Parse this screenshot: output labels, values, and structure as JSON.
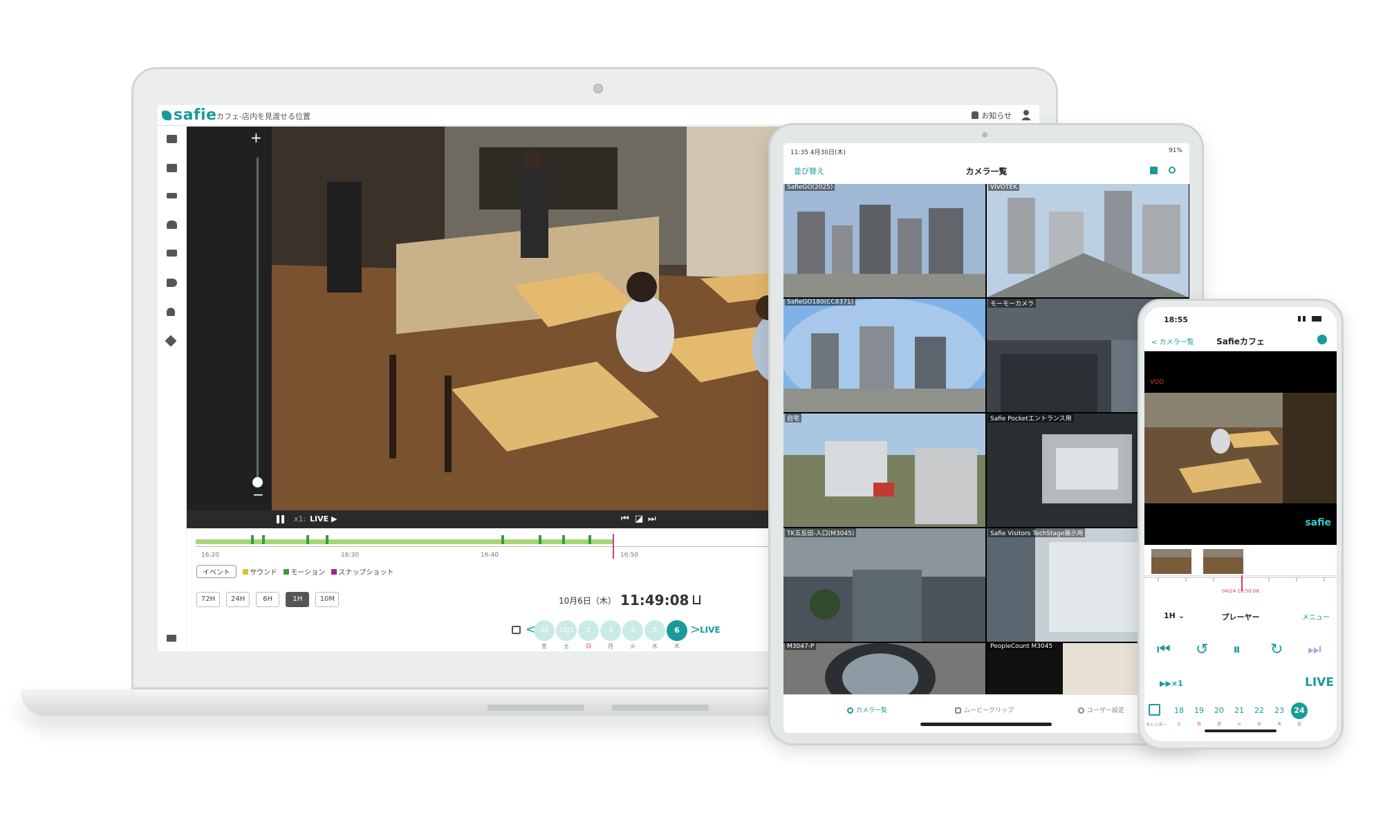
{
  "laptop": {
    "logo": "safie",
    "page_title": "カフェ-店内を見渡せる位置",
    "notice_label": "お知らせ",
    "sidebar_icons": [
      "camera-icon",
      "recorder-icon",
      "storage-icon",
      "cloud-download-icon",
      "list-check-icon",
      "megaphone-icon",
      "person-icon",
      "wrench-icon"
    ],
    "player": {
      "zoom_plus": "+",
      "zoom_minus": "−",
      "speed": "x1:",
      "live": "LIVE ▶",
      "prev_button": "⏮",
      "snapshot_button": "◪",
      "next_button": "⏭"
    },
    "timeline": {
      "ticks": [
        "16:20",
        "16:30",
        "16:40",
        "16:50"
      ]
    },
    "legend": {
      "box_label": "イベント",
      "items": [
        {
          "label": "サウンド",
          "color": "#d8c22a"
        },
        {
          "label": "モーション",
          "color": "#3a9b3a"
        },
        {
          "label": "スナップショット",
          "color": "#a020a0"
        }
      ]
    },
    "range_buttons": [
      {
        "label": "72H",
        "selected": false
      },
      {
        "label": "24H",
        "selected": false
      },
      {
        "label": "6H",
        "selected": false
      },
      {
        "label": "1H",
        "selected": true
      },
      {
        "label": "10M",
        "selected": false
      }
    ],
    "datetime": {
      "date": "10月6日（木）",
      "time": "11:49:08"
    },
    "date_strip": {
      "days": [
        {
          "day": "30",
          "wd": "金"
        },
        {
          "day": "10/1",
          "wd": "土"
        },
        {
          "day": "2",
          "wd": "日"
        },
        {
          "day": "3",
          "wd": "月"
        },
        {
          "day": "4",
          "wd": "火"
        },
        {
          "day": "5",
          "wd": "水"
        },
        {
          "day": "6",
          "wd": "木"
        }
      ],
      "prev": "<",
      "next": ">",
      "live": "LIVE"
    },
    "help": "?",
    "expand": ">"
  },
  "tablet": {
    "status_time": "11:35  4月30日(木)",
    "battery": "91%",
    "sort_label": "並び替え",
    "title": "カメラ一覧",
    "cameras": [
      {
        "name": "SafieGO(2025)"
      },
      {
        "name": "VIVOTEK"
      },
      {
        "name": "SafieGO180(CC8371)"
      },
      {
        "name": "モーモーカメラ"
      },
      {
        "name": "自宅"
      },
      {
        "name": "Safie Pocketエントランス用"
      },
      {
        "name": "TK五反田-入口(M3045)"
      },
      {
        "name": "Safie Visitors TechStage展示用"
      },
      {
        "name": "M3047-P"
      },
      {
        "name": "PeopleCount M3045"
      }
    ],
    "tabs": [
      {
        "label": "カメラ一覧",
        "active": true
      },
      {
        "label": "ムービークリップ",
        "active": false
      },
      {
        "label": "ユーザー設定",
        "active": false
      }
    ]
  },
  "phone": {
    "time": "18:55",
    "back": "< カメラ一覧",
    "title": "Safieカフェ",
    "vod": "VOD",
    "logo": "safie",
    "timeline_date": "04/24 18:50:08",
    "range": "1H ⌄",
    "player_label": "プレーヤー",
    "menu": "メニュー",
    "speed": "▶▶×1",
    "live": "LIVE",
    "calendar_label": "カレンダー",
    "days": [
      {
        "day": "18",
        "wd": "土"
      },
      {
        "day": "19",
        "wd": "日"
      },
      {
        "day": "20",
        "wd": "月"
      },
      {
        "day": "21",
        "wd": "火"
      },
      {
        "day": "22",
        "wd": "水"
      },
      {
        "day": "23",
        "wd": "木"
      },
      {
        "day": "24",
        "wd": "金"
      }
    ]
  },
  "colors": {
    "accent": "#1a9a9a",
    "playhead": "#d23d6e",
    "timeline": "#a8d47a"
  }
}
